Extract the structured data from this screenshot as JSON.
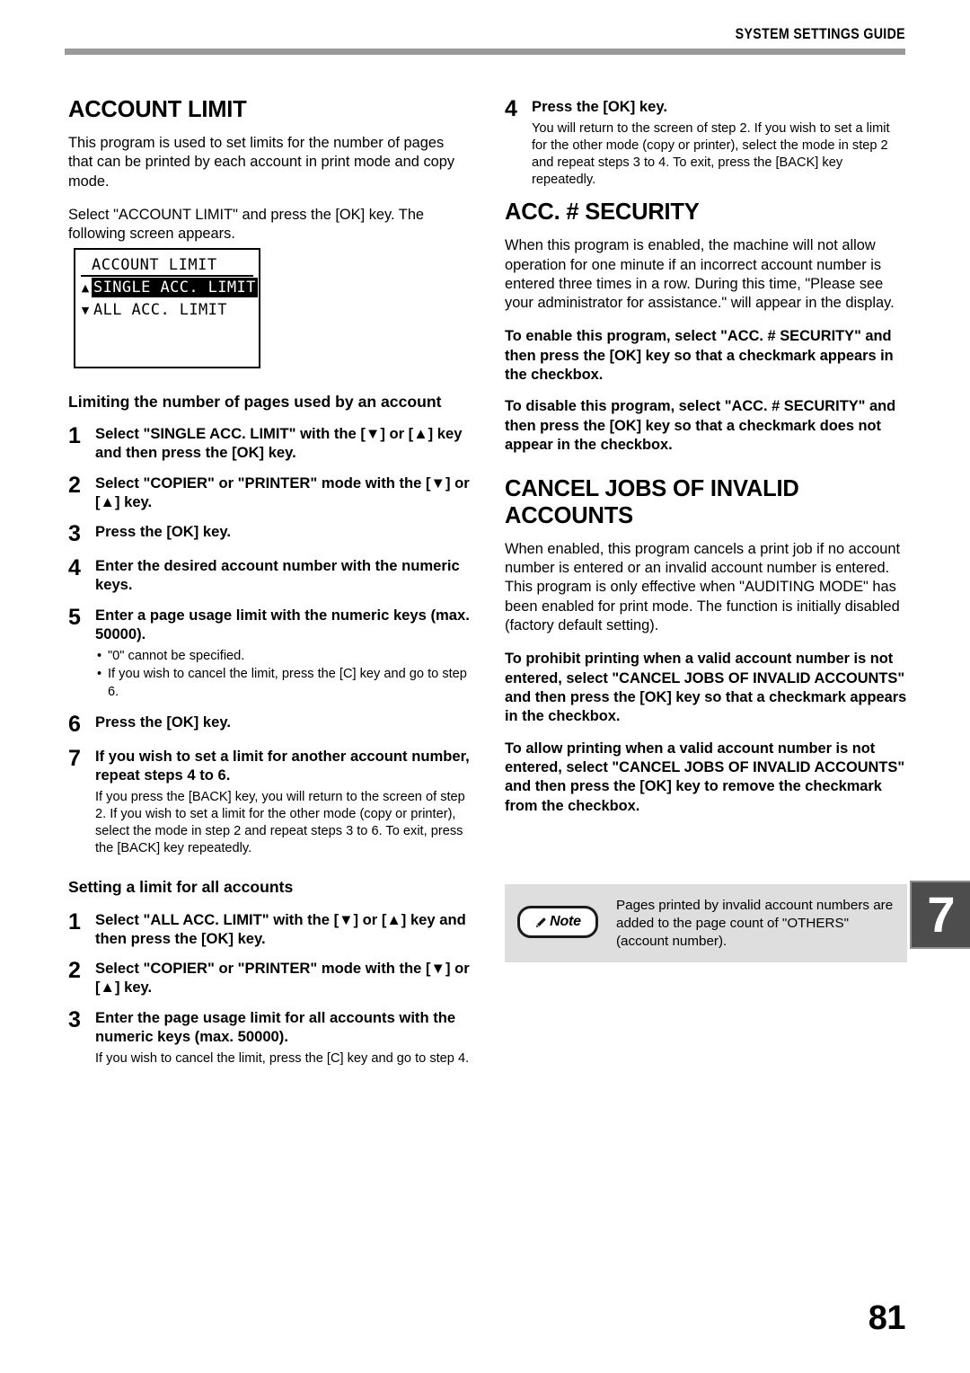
{
  "header": {
    "title": "SYSTEM SETTINGS GUIDE"
  },
  "page_number": "81",
  "chapter_tab": {
    "number": "7"
  },
  "left_column": {
    "section_title": "ACCOUNT LIMIT",
    "intro_paragraph": "This program is used to set limits for the number of pages that can be printed by each account in print mode and copy mode.",
    "select_paragraph": "Select \"ACCOUNT LIMIT\" and press the [OK] key. The following screen appears.",
    "lcd_screen": {
      "title": "ACCOUNT LIMIT",
      "rows": [
        {
          "arrow": "▲",
          "label": "SINGLE ACC. LIMIT",
          "selected": true
        },
        {
          "arrow": "▼",
          "label": "ALL ACC. LIMIT",
          "selected": false
        }
      ]
    },
    "subsection_1": {
      "title": "Limiting the number of pages used by an account",
      "steps": [
        {
          "num": "1",
          "text": "Select \"SINGLE ACC. LIMIT\" with the [▼] or [▲] key and then press the [OK] key."
        },
        {
          "num": "2",
          "text": "Select \"COPIER\" or \"PRINTER\" mode with the [▼] or [▲] key."
        },
        {
          "num": "3",
          "text": "Press the [OK] key."
        },
        {
          "num": "4",
          "text": "Enter the desired account number with the numeric keys."
        },
        {
          "num": "5",
          "text": "Enter a page usage limit with the numeric keys (max. 50000).",
          "bullets": [
            "\"0\" cannot be specified.",
            "If you wish to cancel the limit, press the [C] key and go to step 6."
          ]
        },
        {
          "num": "6",
          "text": "Press the [OK] key."
        },
        {
          "num": "7",
          "text": "If you wish to set a limit for another account number, repeat steps 4 to 6.",
          "note": "If you press the [BACK] key, you will return to the screen of step 2. If you wish to set a limit for the other mode (copy or printer), select the mode in step 2 and repeat steps 3 to 6. To exit, press the [BACK] key repeatedly."
        }
      ]
    },
    "subsection_2": {
      "title": "Setting a limit for all accounts",
      "steps": [
        {
          "num": "1",
          "text": "Select \"ALL ACC. LIMIT\" with the [▼] or [▲] key and then press the [OK] key."
        },
        {
          "num": "2",
          "text": "Select \"COPIER\" or \"PRINTER\" mode with the [▼] or [▲] key."
        },
        {
          "num": "3",
          "text": "Enter the page usage limit for all accounts with the numeric keys (max. 50000).",
          "note": "If you wish to cancel the limit, press the [C] key and go to step 4."
        }
      ]
    }
  },
  "right_column": {
    "step_4": {
      "num": "4",
      "text": "Press the [OK] key.",
      "note": "You will return to the screen of step 2. If you wish to set a limit for the other mode (copy or printer), select the mode in step 2 and repeat steps 3 to 4. To exit, press the [BACK] key repeatedly."
    },
    "acc_security": {
      "section_title": "ACC. # SECURITY",
      "paragraph": "When this program is enabled, the machine will not allow operation for one minute if an incorrect account number is entered three times in a row. During this time, \"Please see your administrator for assistance.\" will appear in the display.",
      "enable_paragraph": "To enable this program, select \"ACC. # SECURITY\" and then press the [OK] key so that a checkmark appears in the checkbox.",
      "disable_paragraph": "To disable this program, select \"ACC. # SECURITY\" and then press the [OK] key so that a checkmark does not appear in the checkbox."
    },
    "cancel_jobs": {
      "section_title": "CANCEL JOBS OF INVALID ACCOUNTS",
      "paragraph": "When enabled, this program cancels a print job if no account number is entered or an invalid account number is entered. This program is only effective when \"AUDITING MODE\" has been enabled for print mode. The function is initially disabled (factory default setting).",
      "prohibit_paragraph": "To prohibit printing when a valid account number is not entered, select \"CANCEL JOBS OF INVALID ACCOUNTS\" and then press the [OK] key so that a checkmark appears in the checkbox.",
      "allow_paragraph": "To allow printing when a valid account number is not entered, select \"CANCEL JOBS OF INVALID ACCOUNTS\" and then press the [OK] key to remove the checkmark from the checkbox."
    },
    "note_box": {
      "badge_label": "Note",
      "text": "Pages printed by invalid account numbers are added to the page count of \"OTHERS\" (account number)."
    }
  }
}
